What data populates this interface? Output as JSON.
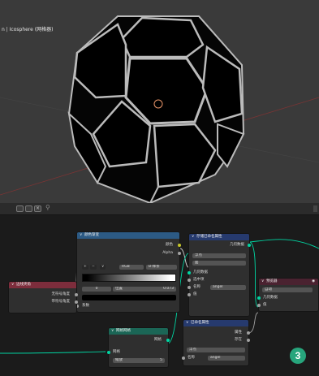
{
  "viewport": {
    "object_label": "n | Icosphere (网格器)"
  },
  "node_editor": {
    "header_icons": [
      "editor-type-icon",
      "copy-icon",
      "close-icon",
      "pin-icon"
    ]
  },
  "nodes": {
    "color_ramp": {
      "title": "颜色渐变",
      "out_color": "颜色",
      "out_alpha": "Alpha",
      "btn_add": "+",
      "btn_remove": "−",
      "btn_menu": "∨",
      "mode": "RGB",
      "interp": "B-样条",
      "index": "0",
      "pos_label": "位置",
      "pos_value": "0.073",
      "in_fac": "系数"
    },
    "store_attr": {
      "title": "存储已命名属性",
      "in_geometry": "几何数据",
      "type_select": "浮点",
      "domain_select": "面",
      "in_geo2": "几何数据",
      "in_selection": "选中项",
      "in_name_label": "名称",
      "in_name_value": "angel",
      "in_value": "值"
    },
    "edge_angle": {
      "title": "边线夹角",
      "out_unsigned": "无符号角度",
      "out_signed": "带符号角度"
    },
    "viewer": {
      "title": "预览器",
      "auto": "自动",
      "geo": "几何数据",
      "val": "值"
    },
    "mesh_line": {
      "title": "网格网格",
      "out_mesh": "网格",
      "in_mesh": "网格",
      "count_label": "缩放",
      "count_value": "5"
    },
    "named_attr": {
      "title": "已命名属性",
      "out_attr": "属性",
      "out_exists": "存在",
      "type_select": "浮点",
      "name_label": "名称",
      "name_value": "angel"
    }
  },
  "step_badge": "3",
  "colors": {
    "accent_green": "#27a57c",
    "geometry_socket": "#00d6a3",
    "edge_angle_header": "#7d2d3c",
    "ramp_header": "#2c5a84",
    "attr_header": "#263a6e",
    "mesh_header": "#1b6656"
  }
}
